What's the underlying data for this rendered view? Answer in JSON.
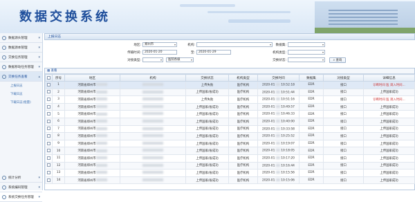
{
  "banner": {
    "title": "数据交换系统"
  },
  "sidebar": {
    "items": [
      {
        "label": "数据源头管理"
      },
      {
        "label": "数据源本管理"
      },
      {
        "label": "交换任务管理"
      },
      {
        "label": "数据移动任务管理"
      },
      {
        "label": "交换任务查看"
      }
    ],
    "sub_items": [
      {
        "label": "上报日志"
      },
      {
        "label": "下载日志"
      },
      {
        "label": "下载日志(批量)"
      }
    ],
    "items2": [
      {
        "label": "统计分析"
      },
      {
        "label": "系统编码管理"
      },
      {
        "label": "系统交换任务管理"
      }
    ]
  },
  "filter": {
    "panel_title": "上报日志",
    "area_label": "地区:",
    "area_value": "郑州市",
    "org_label": "机构:",
    "org_value": "",
    "dataset_label": "数据集:",
    "dataset_value": "",
    "date_label": "传输时间:",
    "date_from": "2020-01-20",
    "to_label": "至:",
    "date_to": "2020-01-29",
    "org_type_label": "机构类型:",
    "org_type_value": "",
    "interface_label": "对接类型:",
    "interface_value": "",
    "reason_label": "",
    "reason_value": "医院各级",
    "status_label": "交换状态:",
    "status_value": "",
    "search_label": "查询"
  },
  "grid": {
    "toolbar_label": "查看",
    "columns": [
      "序号",
      "地区",
      "机构",
      "交换状态",
      "机构类型",
      "交换时间",
      "数据集",
      "对接类型",
      "详细信息"
    ],
    "rows": [
      {
        "no": "1",
        "area": "河南省郑州市",
        "status": "上传失败",
        "orgtype": "医疗机构",
        "date": "2020-01",
        "time": "10:52:18",
        "ds": "EDR",
        "iface": "接口",
        "detail": "诊断时间 医 调入时间..."
      },
      {
        "no": "2",
        "area": "河南省郑州市",
        "status": "上传国家/省成功",
        "orgtype": "医疗机构",
        "date": "2020-01",
        "time": "10:51:44",
        "ds": "EDR",
        "iface": "接口",
        "detail": "上传国家成功"
      },
      {
        "no": "3",
        "area": "河南省郑州市",
        "status": "上传失败",
        "orgtype": "医疗机构",
        "date": "2020-01",
        "time": "10:51:16",
        "ds": "EDR",
        "iface": "接口",
        "detail": "诊断时间 医 调入时间..."
      },
      {
        "no": "4",
        "area": "河南省郑州市",
        "status": "上传国家/省成功",
        "orgtype": "医疗机构",
        "date": "2020-01",
        "time": "10:49:57",
        "ds": "EDR",
        "iface": "接口",
        "detail": "上传国家成功"
      },
      {
        "no": "5",
        "area": "河南省郑州市",
        "status": "上传国家/省成功",
        "orgtype": "医疗机构",
        "date": "2020-01",
        "time": "10:46:33",
        "ds": "EDR",
        "iface": "接口",
        "detail": "上传国家成功"
      },
      {
        "no": "6",
        "area": "河南省郑州市",
        "status": "上传国家/省成功",
        "orgtype": "医疗机构",
        "date": "2020-01",
        "time": "10:40:00",
        "ds": "EDR",
        "iface": "接口",
        "detail": "上传国家成功"
      },
      {
        "no": "7",
        "area": "河南省郑州市",
        "status": "上传国家/省成功",
        "orgtype": "医疗机构",
        "date": "2020-01",
        "time": "10:33:58",
        "ds": "EDR",
        "iface": "接口",
        "detail": "上传国家成功"
      },
      {
        "no": "8",
        "area": "河南省郑州市",
        "status": "上传国家/省成功",
        "orgtype": "医疗机构",
        "date": "2020-01",
        "time": "10:25:52",
        "ds": "EDR",
        "iface": "接口",
        "detail": "上传国家成功"
      },
      {
        "no": "9",
        "area": "河南省郑州市",
        "status": "上传国家/省成功",
        "orgtype": "医疗机构",
        "date": "2020-01",
        "time": "10:19:07",
        "ds": "EDR",
        "iface": "接口",
        "detail": "上传国家成功"
      },
      {
        "no": "10",
        "area": "河南省郑州市",
        "status": "上传国家/省成功",
        "orgtype": "医疗机构",
        "date": "2020-01",
        "time": "10:18:05",
        "ds": "EDR",
        "iface": "接口",
        "detail": "上传国家成功"
      },
      {
        "no": "11",
        "area": "河南省郑州市",
        "status": "上传国家/省成功",
        "orgtype": "医疗机构",
        "date": "2020-01",
        "time": "10:17:20",
        "ds": "EDR",
        "iface": "接口",
        "detail": "上传国家成功"
      },
      {
        "no": "12",
        "area": "河南省郑州市",
        "status": "上传国家/省成功",
        "orgtype": "医疗机构",
        "date": "2020-01",
        "time": "10:16:44",
        "ds": "EDR",
        "iface": "接口",
        "detail": "上传国家成功"
      },
      {
        "no": "13",
        "area": "河南省郑州市",
        "status": "上传国家/省成功",
        "orgtype": "医疗机构",
        "date": "2020-01",
        "time": "10:15:56",
        "ds": "EDR",
        "iface": "接口",
        "detail": "上传国家成功"
      },
      {
        "no": "14",
        "area": "河南省郑州市",
        "status": "上传国家/省成功",
        "orgtype": "医疗机构",
        "date": "2020-01",
        "time": "10:15:06",
        "ds": "EDR",
        "iface": "接口",
        "detail": "上传国家成功"
      }
    ]
  }
}
